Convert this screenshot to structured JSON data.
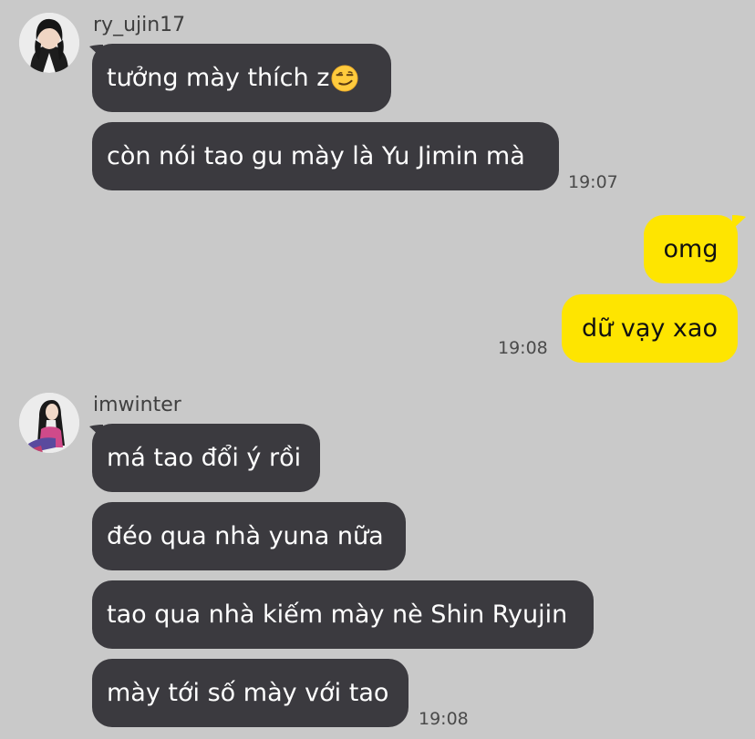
{
  "senders": {
    "first": {
      "name": "ry_ujin17"
    },
    "second": {
      "name": "imwinter"
    }
  },
  "messages": {
    "m1": {
      "text": "tưởng mày thích z",
      "emoji": "smirking-face-emoji"
    },
    "m2": {
      "text": "còn nói tao gu mày là Yu Jimin mà",
      "time": "19:07"
    },
    "m3": {
      "text": "omg"
    },
    "m4": {
      "text": "dữ vạy xao",
      "time": "19:08"
    },
    "m5": {
      "text": "má tao đổi ý rồi"
    },
    "m6": {
      "text": "đéo qua nhà yuna nữa"
    },
    "m7": {
      "text": "tao qua nhà kiếm mày nè Shin Ryujin"
    },
    "m8": {
      "text": "mày tới số mày với tao",
      "time": "19:08"
    }
  },
  "colors": {
    "background": "#c9c9c9",
    "incoming_bubble": "#3b3a3f",
    "outgoing_bubble": "#fee500"
  }
}
